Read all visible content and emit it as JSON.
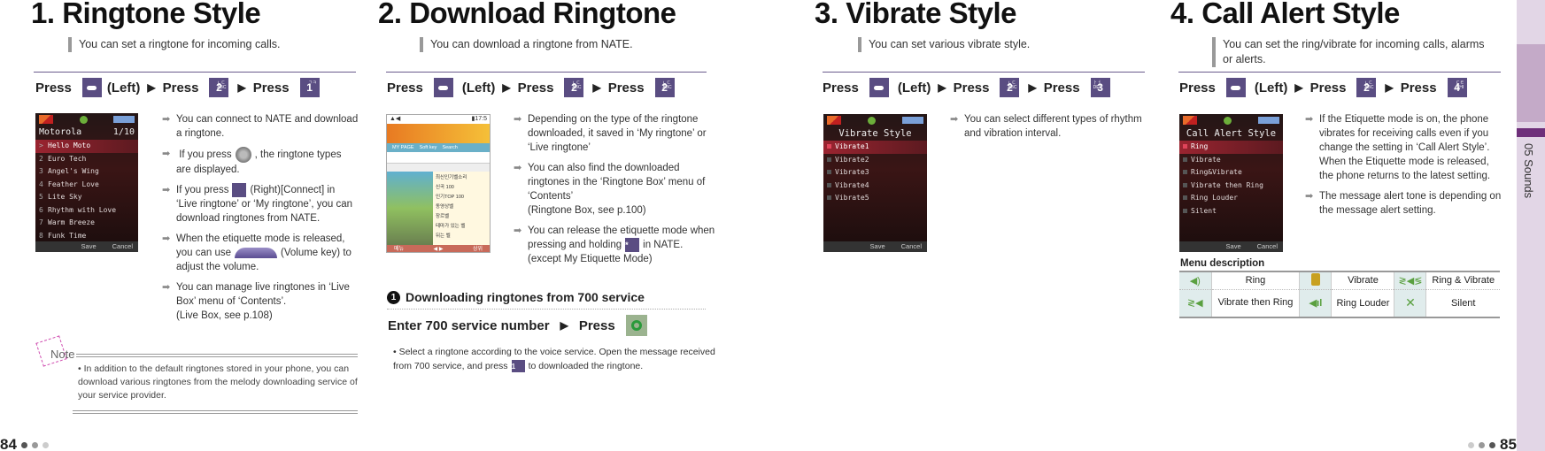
{
  "sections": [
    {
      "number": "1.",
      "title": "Ringtone Style",
      "subtitle": "You can set a ringtone for incoming calls.",
      "press": {
        "word": "Press",
        "left_label": "(Left)",
        "keys": [
          "minus",
          "2",
          "1"
        ]
      },
      "phone": {
        "title": "Motorola",
        "page": "1/10",
        "items": [
          "Hello Moto",
          "Euro Tech",
          "Angel's Wing",
          "Feather Love",
          "Lite Sky",
          "Rhythm with Love",
          "Warm Breeze",
          "Funk Time"
        ],
        "selected_index": 0,
        "soft_save": "Save",
        "soft_cancel": "Cancel"
      },
      "bullets": [
        {
          "text": "You can connect to NATE and download a ringtone."
        },
        {
          "before": "If you press",
          "icon": "nav-dial-icon",
          "after": ", the ringtone types are displayed."
        },
        {
          "before": "If you press",
          "icon": "minus-key-icon",
          "after": "(Right)[Connect] in ‘Live ringtone’ or ‘My ringtone’, you can download ringtones from NATE."
        },
        {
          "before": "When the etiquette mode is released, you can use",
          "icon": "volume-key-icon",
          "after": "(Volume key) to adjust the volume."
        },
        {
          "text": "You can manage live ringtones in ‘Live Box’ menu of ‘Contents’.",
          "text2": "(Live Box, see p.108)"
        }
      ],
      "note": {
        "label": "Note",
        "text": "• In addition to the default ringtones stored in your phone, you can download various ringtones from the melody downloading service of your service provider."
      }
    },
    {
      "number": "2.",
      "title": "Download Ringtone",
      "subtitle": "You can download a ringtone from NATE.",
      "press": {
        "word": "Press",
        "left_label": "(Left)",
        "keys": [
          "minus",
          "2",
          "2"
        ]
      },
      "nate_screen": {
        "tabs": [
          "MY PAGE",
          "Soft key",
          "Search"
        ],
        "list": [
          "최신인기벨소리",
          "신곡 100",
          "인기TOP 100",
          "동영상벨",
          "장르벨",
          "테마가 있는 벨",
          "뒤는 벨"
        ],
        "soft_left": "메뉴",
        "soft_right": "상위"
      },
      "bullets": [
        {
          "text": "Depending on the type of the ringtone downloaded, it saved in ‘My ringtone’ or ‘Live ringtone’"
        },
        {
          "text": "You can also find the downloaded ringtones in the ‘Ringtone Box’ menu of ‘Contents’",
          "text2": "(Ringtone Box, see p.100)"
        },
        {
          "before": "You can release the etiquette mode when pressing and holding",
          "icon": "star-key-icon",
          "after": "in NATE.",
          "text2": "(except My Etiquette Mode)"
        }
      ],
      "subsection": {
        "marker": "1",
        "heading": "Downloading ringtones from 700 service",
        "instruction": "Enter 700 service number",
        "press_word": "Press",
        "body_before": "• Select a ringtone according to the voice service. Open the message received from 700 service, and press",
        "body_after": "to downloaded the ringtone."
      }
    },
    {
      "number": "3.",
      "title": "Vibrate Style",
      "subtitle": "You can set various vibrate style.",
      "press": {
        "word": "Press",
        "left_label": "(Left)",
        "keys": [
          "minus",
          "2",
          "3"
        ]
      },
      "phone": {
        "title": "Vibrate Style",
        "items": [
          "Vibrate1",
          "Vibrate2",
          "Vibrate3",
          "Vibrate4",
          "Vibrate5"
        ],
        "selected_index": 0,
        "soft_save": "Save",
        "soft_cancel": "Cancel"
      },
      "bullets": [
        {
          "text": "You can select different types of rhythm and vibration interval."
        }
      ]
    },
    {
      "number": "4.",
      "title": "Call Alert Style",
      "subtitle": "You can set the ring/vibrate for incoming calls, alarms or alerts.",
      "press": {
        "word": "Press",
        "left_label": "(Left)",
        "keys": [
          "minus",
          "2",
          "4"
        ]
      },
      "phone": {
        "title": "Call Alert Style",
        "items": [
          "Ring",
          "Vibrate",
          "Ring&Vibrate",
          "Vibrate then Ring",
          "Ring Louder",
          "Silent"
        ],
        "selected_index": 0,
        "soft_save": "Save",
        "soft_cancel": "Cancel"
      },
      "bullets": [
        {
          "text": "If the Etiquette mode is on, the phone vibrates for receiving calls even if you change the setting in ‘Call Alert Style’. When the Etiquette mode is released, the phone returns to the latest setting."
        },
        {
          "text": "The message alert tone is depending on the message alert setting."
        }
      ],
      "menu_description": {
        "title": "Menu description",
        "rows": [
          [
            {
              "icon": "ring-icon",
              "label": "Ring"
            },
            {
              "icon": "vibrate-icon",
              "label": "Vibrate"
            },
            {
              "icon": "ring-and-vibrate-icon",
              "label": "Ring & Vibrate"
            }
          ],
          [
            {
              "icon": "vibrate-then-ring-icon",
              "label": "Vibrate then Ring"
            },
            {
              "icon": "ring-louder-icon",
              "label": "Ring Louder"
            },
            {
              "icon": "silent-icon",
              "label": "Silent"
            }
          ]
        ]
      }
    }
  ],
  "footer": {
    "left_page": "84",
    "right_page": "85"
  },
  "side_tab": {
    "label": "05 Sounds",
    "accent": "#6e2f7a"
  },
  "colors": {
    "key_purple": "#5a4d82",
    "rule": "#6a5a8c",
    "table_icon_bg": "#e0ecec"
  }
}
